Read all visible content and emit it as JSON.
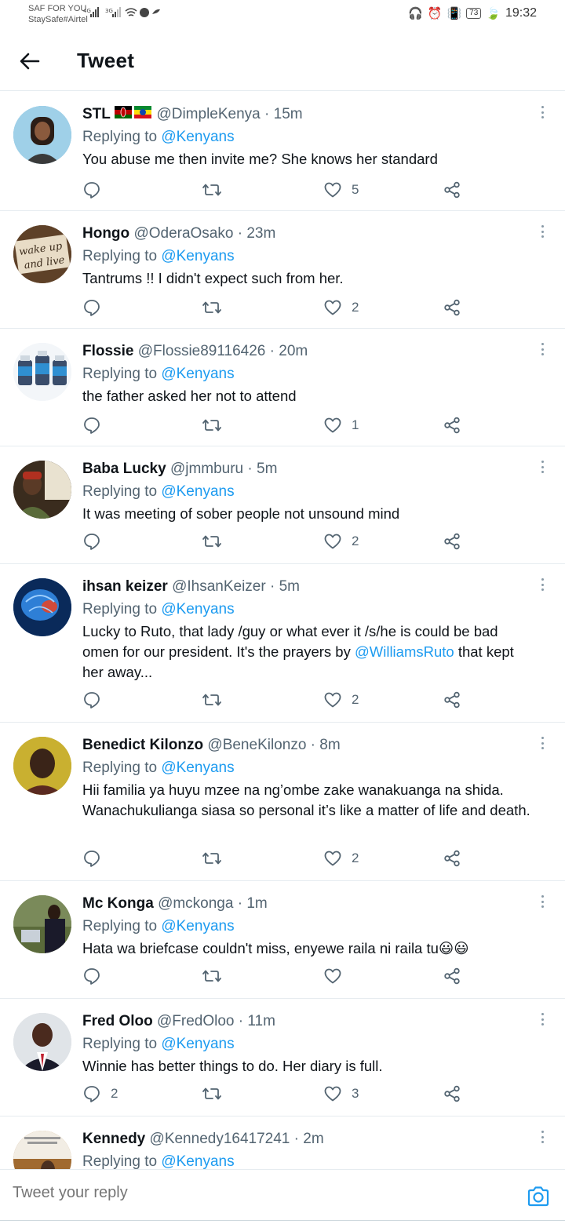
{
  "status_bar": {
    "carrier": "SAF FOR YOU",
    "carrier_sub": "StaySafe#Airtel",
    "battery": "73",
    "time": "19:32"
  },
  "header": {
    "title": "Tweet"
  },
  "tweets": [
    {
      "name": "STL",
      "handle": "@DimpleKenya",
      "time": "· 15m",
      "replying_to_label": "Replying to",
      "replying_to": "@Kenyans",
      "text": "You abuse me then invite me? She knows her standard",
      "replies": "",
      "likes": "5",
      "avatar_color": "#6bb3d8"
    },
    {
      "name": "Hongo",
      "handle": "@OderaOsako",
      "time": "· 23m",
      "replying_to_label": "Replying to",
      "replying_to": "@Kenyans",
      "text": "Tantrums !! I didn't expect such from her.",
      "replies": "",
      "likes": "2",
      "avatar_color": "#7a5a3a",
      "avatar_text_1": "wake up",
      "avatar_text_2": "and live"
    },
    {
      "name": "Flossie",
      "handle": "@Flossie89116426",
      "time": "· 20m",
      "replying_to_label": "Replying to",
      "replying_to": "@Kenyans",
      "text": "the father asked her not to attend",
      "replies": "",
      "likes": "1",
      "avatar_color": "#eef3f7"
    },
    {
      "name": "Baba Lucky",
      "handle": "@jmmburu",
      "time": "· 5m",
      "replying_to_label": "Replying to",
      "replying_to": "@Kenyans",
      "text": "It was meeting of sober people not unsound mind",
      "replies": "",
      "likes": "2",
      "avatar_color": "#4a3a28"
    },
    {
      "name": "ihsan keizer",
      "handle": "@IhsanKeizer",
      "time": "· 5m",
      "replying_to_label": "Replying to",
      "replying_to": "@Kenyans",
      "text_before": "Lucky to Ruto, that lady /guy or what ever it /s/he is could be bad omen for our president. It's the prayers by ",
      "text_mention": "@WilliamsRuto",
      "text_after": " that kept her away...",
      "replies": "",
      "likes": "2",
      "avatar_color": "#1e5fa8"
    },
    {
      "name": "Benedict Kilonzo",
      "handle": "@BeneKilonzo",
      "time": "· 8m",
      "replying_to_label": "Replying to",
      "replying_to": "@Kenyans",
      "text": "Hii familia ya huyu mzee na ng’ombe zake wanakuanga na shida. Wanachukulianga siasa so personal it’s like a matter of life and death.",
      "replies": "",
      "likes": "2",
      "avatar_color": "#b59a2a"
    },
    {
      "name": "Mc Konga",
      "handle": "@mckonga",
      "time": "· 1m",
      "replying_to_label": "Replying to",
      "replying_to": "@Kenyans",
      "text": "Hata wa briefcase couldn't miss, enyewe raila ni raila tu😃😃",
      "replies": "",
      "likes": "",
      "avatar_color": "#8a9a6a"
    },
    {
      "name": "Fred Oloo",
      "handle": "@FredOloo",
      "time": "· 11m",
      "replying_to_label": "Replying to",
      "replying_to": "@Kenyans",
      "text": "Winnie has better things to do. Her diary is full.",
      "replies": "2",
      "likes": "3",
      "avatar_color": "#d8dce0"
    },
    {
      "name": "Kennedy",
      "handle": "@Kennedy16417241",
      "time": "· 2m",
      "replying_to_label": "Replying to",
      "replying_to": "@Kenyans",
      "text": "",
      "replies": "",
      "likes": "",
      "avatar_color": "#b07a3a"
    }
  ],
  "reply_bar": {
    "placeholder": "Tweet your reply"
  },
  "colors": {
    "link": "#1d9bf0",
    "secondary_text": "#536471",
    "divider": "#e6ecf0"
  }
}
